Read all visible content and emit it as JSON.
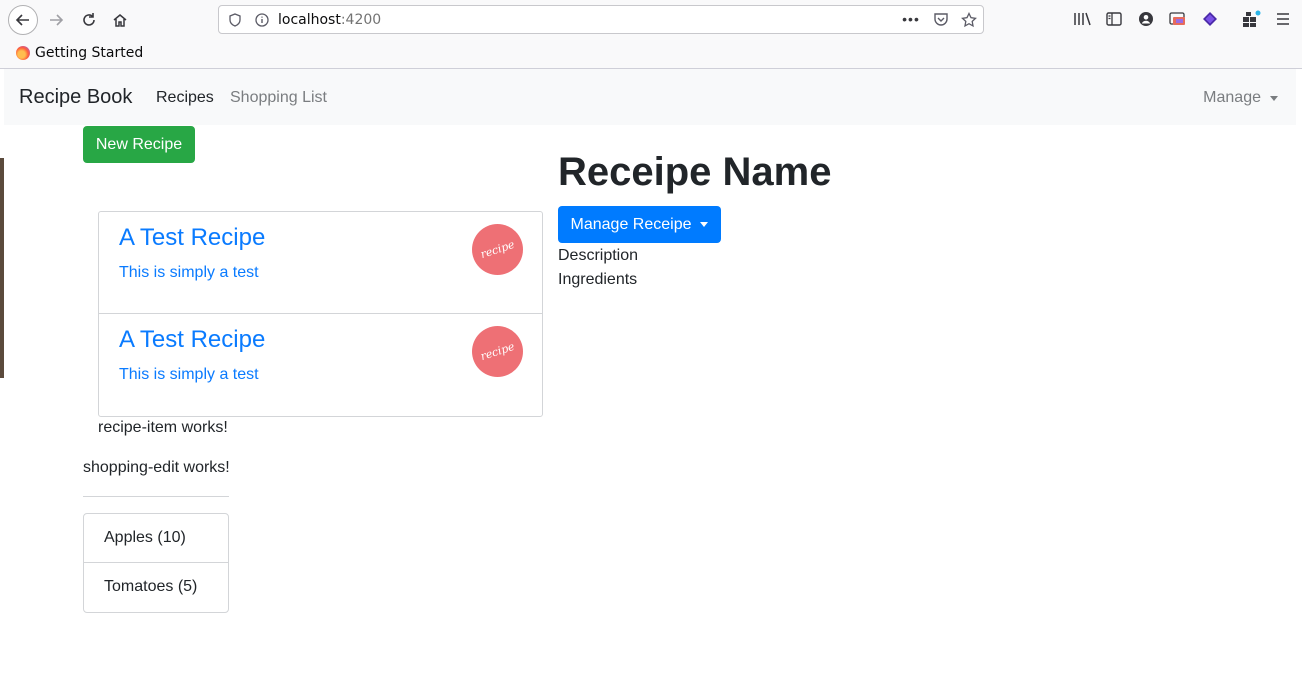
{
  "browser": {
    "url_host": "localhost",
    "url_port": ":4200",
    "bookmark_label": "Getting Started"
  },
  "navbar": {
    "brand": "Recipe Book",
    "links": [
      "Recipes",
      "Shopping List"
    ],
    "manage_label": "Manage"
  },
  "recipes": {
    "new_button": "New Recipe",
    "items": [
      {
        "name": "A Test Recipe",
        "description": "This is simply a test",
        "image_text": "recipe"
      },
      {
        "name": "A Test Recipe",
        "description": "This is simply a test",
        "image_text": "recipe"
      }
    ],
    "item_works_text": "recipe-item works!"
  },
  "shopping": {
    "edit_works_text": "shopping-edit works!",
    "ingredients": [
      "Apples (10)",
      "Tomatoes (5)"
    ]
  },
  "detail": {
    "title": "Receipe Name",
    "manage_button": "Manage Receipe",
    "description_label": "Description",
    "ingredients_label": "Ingredients"
  },
  "colors": {
    "success": "#28a745",
    "primary": "#007bff",
    "link": "#0a7bff",
    "recipe_badge": "#ee7075"
  }
}
